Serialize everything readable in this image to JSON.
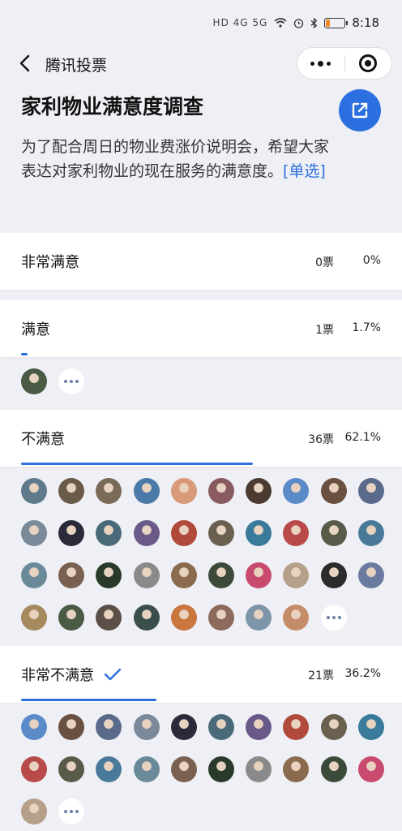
{
  "status_bar": {
    "network_icons": "HD 4G 5G",
    "time": "8:18"
  },
  "nav": {
    "title": "腾讯投票"
  },
  "poll": {
    "title": "家利物业满意度调查",
    "description": "为了配合周日的物业费涨价说明会，希望大家表达对家利物业的现在服务的满意度。",
    "mode_tag": "[单选]"
  },
  "options": [
    {
      "label": "非常满意",
      "votes": "0票",
      "percent": "0%",
      "fraction": 0.0,
      "selected": false,
      "voter_count_shown": 0,
      "more": false
    },
    {
      "label": "满意",
      "votes": "1票",
      "percent": "1.7%",
      "fraction": 0.017,
      "selected": false,
      "voter_count_shown": 1,
      "more": true
    },
    {
      "label": "不满意",
      "votes": "36票",
      "percent": "62.1%",
      "fraction": 0.621,
      "selected": false,
      "voter_count_shown": 38,
      "more": true
    },
    {
      "label": "非常不满意",
      "votes": "21票",
      "percent": "36.2%",
      "fraction": 0.362,
      "selected": true,
      "voter_count_shown": 21,
      "more": true
    }
  ],
  "colors": {
    "accent": "#2b6fe0",
    "background": "#eff0f5",
    "card": "#ffffff"
  }
}
